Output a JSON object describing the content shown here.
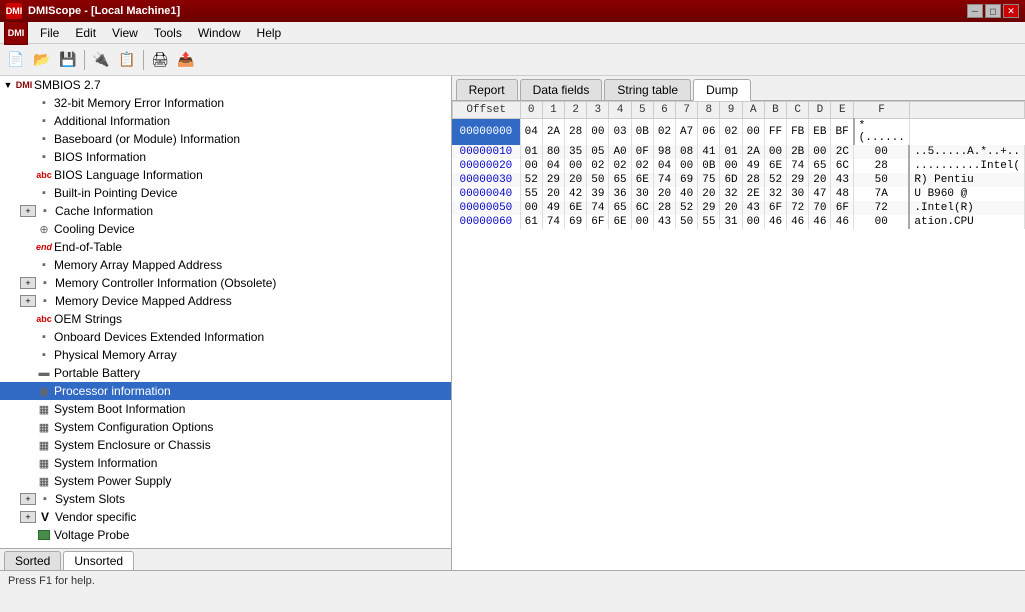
{
  "titleBar": {
    "title": "DMIScope - [Local Machine1]",
    "icon": "DMI",
    "buttons": [
      "minimize",
      "restore",
      "close"
    ]
  },
  "menuBar": {
    "items": [
      "File",
      "Edit",
      "View",
      "Tools",
      "Window",
      "Help"
    ]
  },
  "toolbar": {
    "buttons": [
      "new",
      "open",
      "save",
      "separator",
      "connect",
      "separator",
      "export",
      "separator",
      "about"
    ]
  },
  "tree": {
    "root": {
      "label": "SMBIOS 2.7",
      "expanded": true
    },
    "items": [
      {
        "id": "32bit",
        "label": "32-bit Memory Error Information",
        "icon": "chip",
        "indent": 1,
        "hasExpand": false
      },
      {
        "id": "additional",
        "label": "Additional Information",
        "icon": "chip",
        "indent": 1,
        "hasExpand": false
      },
      {
        "id": "baseboard",
        "label": "Baseboard (or Module) Information",
        "icon": "chip",
        "indent": 1,
        "hasExpand": false
      },
      {
        "id": "bios",
        "label": "BIOS Information",
        "icon": "chip",
        "indent": 1,
        "hasExpand": false
      },
      {
        "id": "bios-lang",
        "label": "BIOS Language Information",
        "icon": "abc",
        "indent": 1,
        "hasExpand": false
      },
      {
        "id": "built-in",
        "label": "Built-in Pointing Device",
        "icon": "chip",
        "indent": 1,
        "hasExpand": false
      },
      {
        "id": "cache",
        "label": "Cache Information",
        "icon": "chip",
        "indent": 1,
        "hasExpand": true,
        "expanded": false
      },
      {
        "id": "cooling",
        "label": "Cooling Device",
        "icon": "fan",
        "indent": 1,
        "hasExpand": false
      },
      {
        "id": "end",
        "label": "End-of-Table",
        "icon": "end",
        "indent": 1,
        "hasExpand": false
      },
      {
        "id": "mem-array",
        "label": "Memory Array Mapped Address",
        "icon": "chip",
        "indent": 1,
        "hasExpand": false
      },
      {
        "id": "mem-ctrl",
        "label": "Memory Controller Information (Obsolete)",
        "icon": "chip",
        "indent": 1,
        "hasExpand": true,
        "expanded": false
      },
      {
        "id": "mem-device",
        "label": "Memory Device Mapped Address",
        "icon": "chip",
        "indent": 1,
        "hasExpand": true,
        "expanded": false
      },
      {
        "id": "oem",
        "label": "OEM Strings",
        "icon": "abc",
        "indent": 1,
        "hasExpand": false
      },
      {
        "id": "onboard",
        "label": "Onboard Devices Extended Information",
        "icon": "chip",
        "indent": 1,
        "hasExpand": false
      },
      {
        "id": "physical",
        "label": "Physical Memory Array",
        "icon": "chip",
        "indent": 1,
        "hasExpand": false
      },
      {
        "id": "portable",
        "label": "Portable Battery",
        "icon": "battery",
        "indent": 1,
        "hasExpand": false
      },
      {
        "id": "processor",
        "label": "Processor information",
        "icon": "cpu",
        "indent": 1,
        "hasExpand": false,
        "selected": true
      },
      {
        "id": "sysboot",
        "label": "System Boot Information",
        "icon": "system",
        "indent": 1,
        "hasExpand": false
      },
      {
        "id": "sysconfopt",
        "label": "System Configuration Options",
        "icon": "system",
        "indent": 1,
        "hasExpand": false
      },
      {
        "id": "sysenclosure",
        "label": "System Enclosure or Chassis",
        "icon": "system",
        "indent": 1,
        "hasExpand": false
      },
      {
        "id": "sysinfo",
        "label": "System Information",
        "icon": "system",
        "indent": 1,
        "hasExpand": false
      },
      {
        "id": "syspwr",
        "label": "System Power Supply",
        "icon": "system",
        "indent": 1,
        "hasExpand": false
      },
      {
        "id": "sysslots",
        "label": "System Slots",
        "icon": "chip",
        "indent": 1,
        "hasExpand": true,
        "expanded": false
      },
      {
        "id": "vendor",
        "label": "Vendor specific",
        "icon": "v",
        "indent": 1,
        "hasExpand": true,
        "expanded": false
      },
      {
        "id": "voltage",
        "label": "Voltage Probe",
        "icon": "green",
        "indent": 1,
        "hasExpand": false
      }
    ]
  },
  "tabs": {
    "items": [
      "Report",
      "Data fields",
      "String table",
      "Dump"
    ],
    "active": "Dump"
  },
  "dump": {
    "headers": [
      "Offset",
      "0",
      "1",
      "2",
      "3",
      "4",
      "5",
      "6",
      "7",
      "8",
      "9",
      "A",
      "B",
      "C",
      "D",
      "E",
      "F",
      ""
    ],
    "rows": [
      {
        "offset": "00000000",
        "bytes": [
          "04",
          "2A",
          "28",
          "00",
          "03",
          "0B",
          "02",
          "A7",
          "06",
          "02",
          "00",
          "FF",
          "FB",
          "EB",
          "BF"
        ],
        "ascii": "*(......"
      },
      {
        "offset": "00000010",
        "bytes": [
          "01",
          "80",
          "35",
          "05",
          "A0",
          "0F",
          "98",
          "08",
          "41",
          "01",
          "2A",
          "00",
          "2B",
          "00",
          "2C",
          "00"
        ],
        "ascii": "..5.....A.*..+.."
      },
      {
        "offset": "00000020",
        "bytes": [
          "00",
          "04",
          "00",
          "02",
          "02",
          "02",
          "04",
          "00",
          "0B",
          "00",
          "49",
          "6E",
          "74",
          "65",
          "6C",
          "28"
        ],
        "ascii": "..........Intel("
      },
      {
        "offset": "00000030",
        "bytes": [
          "52",
          "29",
          "20",
          "50",
          "65",
          "6E",
          "74",
          "69",
          "75",
          "6D",
          "28",
          "52",
          "29",
          "20",
          "43",
          "50"
        ],
        "ascii": "R) Pentiu"
      },
      {
        "offset": "00000040",
        "bytes": [
          "55",
          "20",
          "42",
          "39",
          "36",
          "30",
          "20",
          "40",
          "20",
          "32",
          "2E",
          "32",
          "30",
          "47",
          "48",
          "7A"
        ],
        "ascii": "U B960 @"
      },
      {
        "offset": "00000050",
        "bytes": [
          "00",
          "49",
          "6E",
          "74",
          "65",
          "6C",
          "28",
          "52",
          "29",
          "20",
          "43",
          "6F",
          "72",
          "70",
          "6F",
          "72"
        ],
        "ascii": ".Intel(R)"
      },
      {
        "offset": "00000060",
        "bytes": [
          "61",
          "74",
          "69",
          "6F",
          "6E",
          "00",
          "43",
          "50",
          "55",
          "31",
          "00",
          "46",
          "46",
          "46",
          "46",
          "00"
        ],
        "ascii": "ation.CPU"
      }
    ]
  },
  "bottomTabs": {
    "items": [
      "Sorted",
      "Unsorted"
    ],
    "active": "Unsorted"
  },
  "statusBar": {
    "text": "Press F1 for help."
  }
}
